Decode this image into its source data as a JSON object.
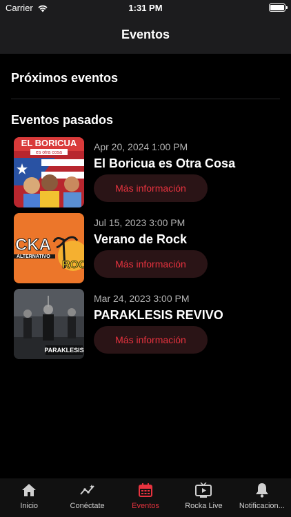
{
  "status_bar": {
    "carrier": "Carrier",
    "time": "1:31 PM"
  },
  "header": {
    "title": "Eventos"
  },
  "upcoming": {
    "title": "Próximos eventos"
  },
  "past": {
    "title": "Eventos pasados",
    "events": [
      {
        "date": "Apr 20, 2024 1:00 PM",
        "title": "El Boricua es Otra Cosa",
        "button": "Más información",
        "thumb_text": "EL BORICUA",
        "thumb_sub": "es otra cosa"
      },
      {
        "date": "Jul 15, 2023 3:00 PM",
        "title": "Verano de Rock",
        "button": "Más información",
        "thumb_text": "CKA",
        "thumb_sub": "ALTERNATIVO"
      },
      {
        "date": "Mar 24, 2023 3:00 PM",
        "title": "PARAKLESIS REVIVO",
        "button": "Más información",
        "thumb_text": "PARAKLESIS"
      }
    ]
  },
  "tabs": [
    {
      "label": "Inicio",
      "icon": "home-icon"
    },
    {
      "label": "Conéctate",
      "icon": "trend-icon"
    },
    {
      "label": "Eventos",
      "icon": "calendar-icon",
      "active": true
    },
    {
      "label": "Rocka Live",
      "icon": "tv-play-icon"
    },
    {
      "label": "Notificacion...",
      "icon": "bell-icon"
    }
  ],
  "colors": {
    "accent": "#e8333f",
    "button_bg": "#2a1416",
    "bar_bg": "#1c1c1e"
  }
}
